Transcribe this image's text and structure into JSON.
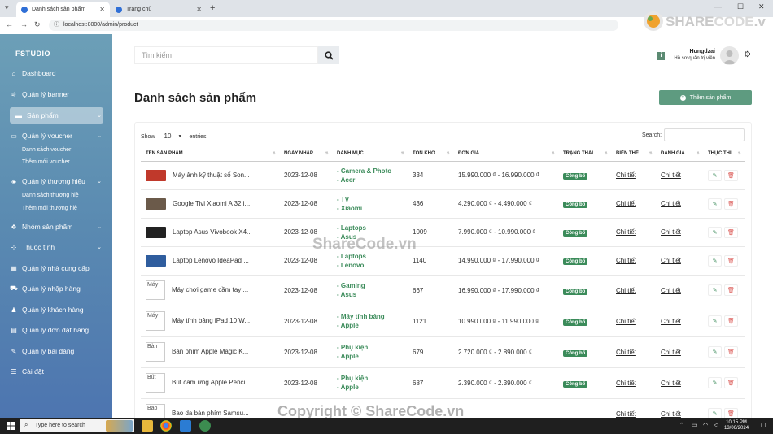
{
  "browser": {
    "tabs": [
      {
        "label": "Danh sách sản phẩm",
        "active": true
      },
      {
        "label": "Trang chủ",
        "active": false
      }
    ],
    "url": "localhost:8000/admin/product"
  },
  "logo": {
    "text_share": "SHARE",
    "text_code": "CODE",
    "text_vn": ".vn"
  },
  "sidebar": {
    "brand": "FSTUDIO",
    "items": [
      {
        "label": "Dashboard",
        "icon": "home-icon"
      },
      {
        "label": "Quản lý banner",
        "icon": "sliders-icon"
      },
      {
        "label": "Sản phẩm",
        "icon": "box-icon",
        "active": true
      },
      {
        "label": "Quản lý voucher",
        "icon": "ticket-icon"
      },
      {
        "label": "Quản lý thương hiệu",
        "icon": "tags-icon"
      },
      {
        "label": "Nhóm sản phẩm",
        "icon": "layers-icon"
      },
      {
        "label": "Thuộc tính",
        "icon": "sitemap-icon"
      },
      {
        "label": "Quản lý nhà cung cấp",
        "icon": "table-icon"
      },
      {
        "label": "Quản lý nhập hàng",
        "icon": "cart-icon"
      },
      {
        "label": "Quản lý khách hàng",
        "icon": "user-icon"
      },
      {
        "label": "Quản lý đơn đặt hàng",
        "icon": "clipboard-icon"
      },
      {
        "label": "Quản lý bài đăng",
        "icon": "edit-icon"
      },
      {
        "label": "Cài đặt",
        "icon": "settings-icon"
      }
    ],
    "voucher_sub": [
      "Danh sách voucher",
      "Thêm mới voucher"
    ],
    "brand_sub": [
      "Danh sách thương hiệ",
      "Thêm mới thương hiệ"
    ]
  },
  "header": {
    "search_placeholder": "Tìm kiếm",
    "user_name": "Hungdzai",
    "user_role": "Hồ sơ quản trị viên"
  },
  "main": {
    "title": "Danh sách sản phẩm",
    "add_button": "Thêm sản phẩm",
    "show_label": "Show",
    "entries_value": "10",
    "entries_label": "entries",
    "search_label": "Search:"
  },
  "table": {
    "columns": [
      "TÊN SẢN PHẨM",
      "NGÀY NHẬP",
      "DANH MỤC",
      "TỒN KHO",
      "ĐƠN GIÁ",
      "TRẠNG THÁI",
      "BIẾN THỂ",
      "ĐÁNH GIÁ",
      "THỰC THI"
    ],
    "rows": [
      {
        "name": "Máy ảnh kỹ thuật số Son...",
        "date": "2023-12-08",
        "cat1": "- Camera & Photo",
        "cat2": "- Acer",
        "stock": "334",
        "price": "15.990.000 ₫ - 16.990.000 ₫",
        "status": "Công bố",
        "variant": "Chi tiết",
        "review": "Chi tiết",
        "thumb": "#c0392b",
        "alt": ""
      },
      {
        "name": "Google Tivi Xiaomi A 32 i...",
        "date": "2023-12-08",
        "cat1": "- TV",
        "cat2": "- Xiaomi",
        "stock": "436",
        "price": "4.290.000 ₫ - 4.490.000 ₫",
        "status": "Công bố",
        "variant": "Chi tiết",
        "review": "Chi tiết",
        "thumb": "#6b5a4a",
        "alt": ""
      },
      {
        "name": "Laptop Asus Vivobook X4...",
        "date": "2023-12-08",
        "cat1": "- Laptops",
        "cat2": "- Asus",
        "stock": "1009",
        "price": "7.990.000 ₫ - 10.990.000 ₫",
        "status": "Công bố",
        "variant": "Chi tiết",
        "review": "Chi tiết",
        "thumb": "#222222",
        "alt": ""
      },
      {
        "name": "Laptop Lenovo IdeaPad ...",
        "date": "2023-12-08",
        "cat1": "- Laptops",
        "cat2": "- Lenovo",
        "stock": "1140",
        "price": "14.990.000 ₫ - 17.990.000 ₫",
        "status": "Công bố",
        "variant": "Chi tiết",
        "review": "Chi tiết",
        "thumb": "#2f5d9e",
        "alt": ""
      },
      {
        "name": "Máy chơi game cầm tay ...",
        "date": "2023-12-08",
        "cat1": "- Gaming",
        "cat2": "- Asus",
        "stock": "667",
        "price": "16.990.000 ₫ - 17.990.000 ₫",
        "status": "Công bố",
        "variant": "Chi tiết",
        "review": "Chi tiết",
        "thumb": "",
        "alt": "Máy"
      },
      {
        "name": "Máy tính bảng iPad 10 W...",
        "date": "2023-12-08",
        "cat1": "- Máy tính bảng",
        "cat2": "- Apple",
        "stock": "1121",
        "price": "10.990.000 ₫ - 11.990.000 ₫",
        "status": "Công bố",
        "variant": "Chi tiết",
        "review": "Chi tiết",
        "thumb": "",
        "alt": "Máy"
      },
      {
        "name": "Bàn phím Apple Magic K...",
        "date": "2023-12-08",
        "cat1": "- Phụ kiện",
        "cat2": "- Apple",
        "stock": "679",
        "price": "2.720.000 ₫ - 2.890.000 ₫",
        "status": "Công bố",
        "variant": "Chi tiết",
        "review": "Chi tiết",
        "thumb": "",
        "alt": "Bàn"
      },
      {
        "name": "Bút cảm ứng Apple Penci...",
        "date": "2023-12-08",
        "cat1": "- Phụ kiện",
        "cat2": "- Apple",
        "stock": "687",
        "price": "2.390.000 ₫ - 2.390.000 ₫",
        "status": "Công bố",
        "variant": "Chi tiết",
        "review": "Chi tiết",
        "thumb": "",
        "alt": "Bút"
      },
      {
        "name": "Bao da bàn phím Samsu...",
        "date": "",
        "cat1": "",
        "cat2": "",
        "stock": "",
        "price": "",
        "status": "",
        "variant": "Chi tiết",
        "review": "Chi tiết",
        "thumb": "",
        "alt": "Bao"
      }
    ]
  },
  "watermark": "ShareCode.vn",
  "copyright": "Copyright © ShareCode.vn",
  "taskbar": {
    "search_placeholder": "Type here to search",
    "time": "10:15 PM",
    "date": "13/06/2024"
  },
  "colors": {
    "accent": "#3b8b5a",
    "sidebar_top": "#6c9fb7",
    "sidebar_bottom": "#4d75b0",
    "danger": "#d9534f"
  }
}
